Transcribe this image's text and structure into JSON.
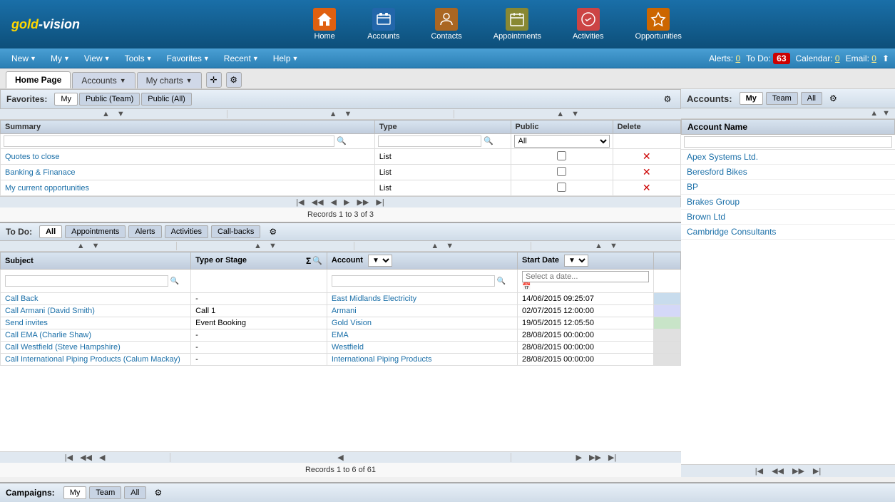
{
  "app": {
    "logo": "gold-vision"
  },
  "topnav": {
    "icons": [
      {
        "id": "home",
        "label": "Home",
        "color": "#e06010"
      },
      {
        "id": "accounts",
        "label": "Accounts",
        "color": "#2266aa"
      },
      {
        "id": "contacts",
        "label": "Contacts",
        "color": "#aa6622"
      },
      {
        "id": "appointments",
        "label": "Appointments",
        "color": "#888833"
      },
      {
        "id": "activities",
        "label": "Activities",
        "color": "#cc4444"
      },
      {
        "id": "opportunities",
        "label": "Opportunities",
        "color": "#cc6600"
      }
    ]
  },
  "menubar": {
    "items": [
      "New",
      "My",
      "View",
      "Tools",
      "Favorites",
      "Recent",
      "Help"
    ],
    "alerts": "Alerts: 0",
    "todo": "To Do:",
    "todo_count": "63",
    "calendar": "Calendar: 0",
    "email": "Email: 0"
  },
  "tabs": {
    "home_page": "Home Page",
    "accounts": "Accounts",
    "my_charts": "My charts"
  },
  "favorites": {
    "label": "Favorites:",
    "tabs": [
      "My",
      "Public (Team)",
      "Public (All)"
    ]
  },
  "favorites_table": {
    "columns": [
      "Summary",
      "Type",
      "Public",
      "Delete"
    ],
    "rows": [
      {
        "summary": "Quotes to close",
        "type": "List",
        "public": false
      },
      {
        "summary": "Banking & Finanace",
        "type": "List",
        "public": false
      },
      {
        "summary": "My current opportunities",
        "type": "List",
        "public": false
      }
    ],
    "records": "Records 1 to 3 of 3"
  },
  "accounts_panel": {
    "label": "Accounts:",
    "tabs": [
      "My",
      "Team",
      "All"
    ],
    "column": "Account Name",
    "items": [
      "Apex Systems Ltd.",
      "Beresford Bikes",
      "BP",
      "Brakes Group",
      "Brown Ltd",
      "Cambridge Consultants"
    ]
  },
  "todo": {
    "label": "To Do:",
    "tabs": [
      "All",
      "Appointments",
      "Alerts",
      "Activities",
      "Call-backs"
    ]
  },
  "todo_table": {
    "columns": [
      "Subject",
      "Type or Stage",
      "Account",
      "Start Date"
    ],
    "rows": [
      {
        "subject": "Call Back",
        "type": "-",
        "account": "East Midlands Electricity",
        "start_date": "14/06/2015 09:25:07"
      },
      {
        "subject": "Call Armani (David Smith)",
        "type": "Call 1",
        "account": "Armani",
        "start_date": "02/07/2015 12:00:00"
      },
      {
        "subject": "Send invites",
        "type": "Event Booking",
        "account": "Gold Vision",
        "start_date": "19/05/2015 12:05:50"
      },
      {
        "subject": "Call EMA (Charlie Shaw)",
        "type": "-",
        "account": "EMA",
        "start_date": "28/08/2015 00:00:00"
      },
      {
        "subject": "Call Westfield (Steve Hampshire)",
        "type": "-",
        "account": "Westfield",
        "start_date": "28/08/2015 00:00:00"
      },
      {
        "subject": "Call International Piping Products (Calum Mackay)",
        "type": "-",
        "account": "International Piping Products",
        "start_date": "28/08/2015 00:00:00"
      }
    ],
    "records": "Records 1 to 6 of 61"
  },
  "campaigns": {
    "label": "Campaigns:",
    "tabs": [
      "My",
      "Team",
      "All"
    ]
  }
}
